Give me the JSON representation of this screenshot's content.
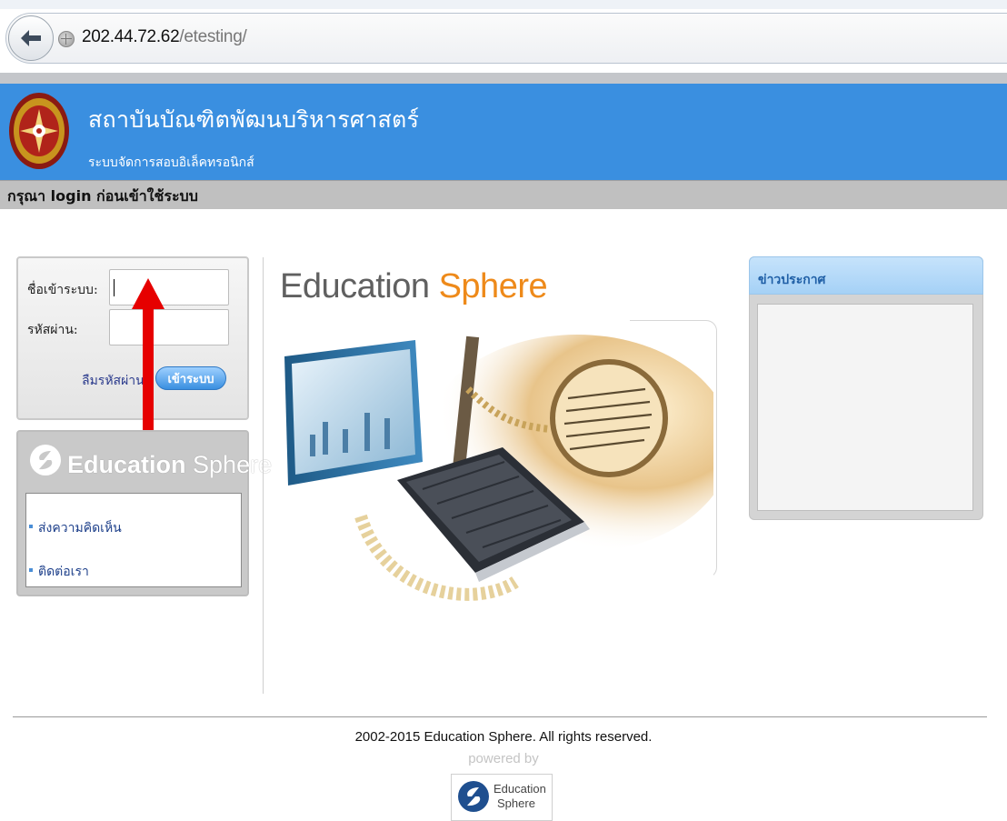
{
  "browser": {
    "url_host": "202.44.72.62",
    "url_path": "/etesting/",
    "back_icon": "back-arrow-icon",
    "site_icon": "globe-icon"
  },
  "header": {
    "title": "สถาบันบัณฑิตพัฒนบริหารศาสตร์",
    "subtitle": "ระบบจัดการสอบอิเล็คทรอนิกส์",
    "login_notice": "กรุณา login ก่อนเข้าใช้ระบบ",
    "accent_color": "#3a8fe0"
  },
  "login": {
    "username_label": "ชื่อเข้าระบบ:",
    "username_value": "",
    "password_label": "รหัสผ่าน:",
    "password_value": "",
    "forgot_label": "ลืมรหัสผ่าน",
    "login_button": "เข้าระบบ"
  },
  "sidebar": {
    "brand_part1": "Education",
    "brand_part2": "Sphere",
    "links": [
      {
        "label": "ส่งความคิดเห็น"
      },
      {
        "label": "ติดต่อเรา"
      }
    ]
  },
  "brand": {
    "part1": "Education",
    "part2": "Sphere",
    "part2_color": "#ee8a1a"
  },
  "news": {
    "title": "ข่าวประกาศ"
  },
  "annotation": {
    "arrow_color": "#e60000"
  },
  "footer": {
    "copyright": "2002-2015 Education Sphere. All rights reserved.",
    "powered_by": "powered by",
    "logo_line1": "Education",
    "logo_line2": "Sphere"
  }
}
